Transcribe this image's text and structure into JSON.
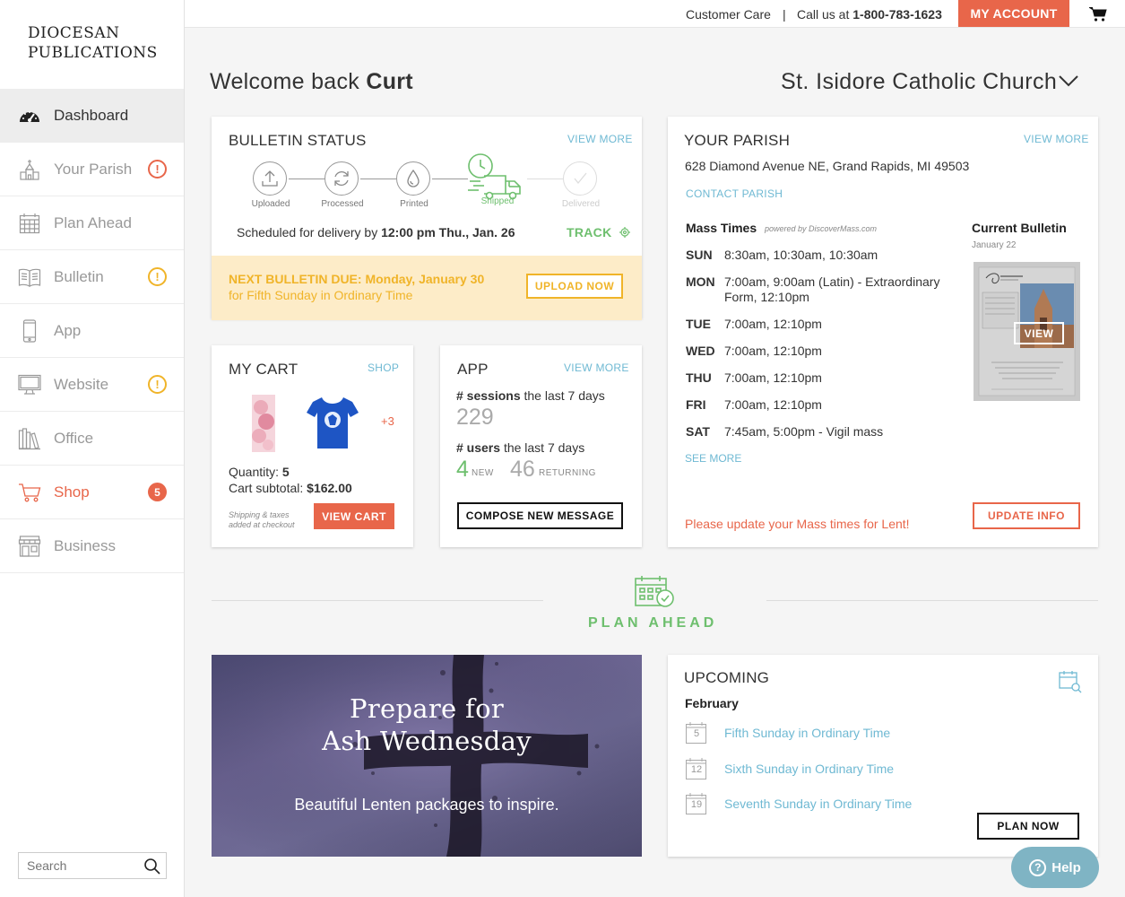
{
  "brand": {
    "line1": "DIOCESAN",
    "line2": "PUBLICATIONS"
  },
  "sidebar": {
    "items": [
      {
        "label": "Dashboard",
        "icon": "gauge-icon",
        "active": true
      },
      {
        "label": "Your Parish",
        "icon": "church-icon",
        "badge": "!"
      },
      {
        "label": "Plan Ahead",
        "icon": "calendar-icon"
      },
      {
        "label": "Bulletin",
        "icon": "book-icon",
        "badge": "!"
      },
      {
        "label": "App",
        "icon": "phone-icon"
      },
      {
        "label": "Website",
        "icon": "monitor-icon",
        "badge": "!"
      },
      {
        "label": "Office",
        "icon": "books-icon"
      },
      {
        "label": "Shop",
        "icon": "cart-icon",
        "badge": "5"
      },
      {
        "label": "Business",
        "icon": "store-icon"
      }
    ],
    "search_placeholder": "Search"
  },
  "topbar": {
    "customer_care": "Customer Care",
    "separator": "|",
    "call_prefix": "Call us at",
    "phone": "1-800-783-1623",
    "my_account": "MY ACCOUNT"
  },
  "welcome": {
    "prefix": "Welcome back",
    "name": "Curt"
  },
  "church": {
    "name": "St. Isidore Catholic Church"
  },
  "bulletin_status": {
    "title": "BULLETIN STATUS",
    "view_more": "VIEW MORE",
    "steps": [
      "Uploaded",
      "Processed",
      "Printed",
      "Shipped",
      "Delivered"
    ],
    "schedule_prefix": "Scheduled for delivery by",
    "schedule_time": "12:00 pm Thu., Jan. 26",
    "track": "TRACK",
    "due_title": "NEXT BULLETIN DUE: Monday, January 30",
    "due_sub": "for Fifth Sunday in Ordinary Time",
    "upload": "UPLOAD NOW"
  },
  "cart": {
    "title": "MY CART",
    "shop": "SHOP",
    "more": "+3",
    "qty_label": "Quantity:",
    "qty": "5",
    "subtotal_label": "Cart subtotal:",
    "subtotal": "$162.00",
    "note1": "Shipping & taxes",
    "note2": "added at checkout",
    "view_cart": "VIEW CART"
  },
  "app": {
    "title": "APP",
    "view_more": "VIEW MORE",
    "sessions_bold": "# sessions",
    "sessions_rest": "the last 7 days",
    "sessions": "229",
    "users_bold": "# users",
    "users_rest": "the last 7 days",
    "new_count": "4",
    "new_label": "NEW",
    "returning_count": "46",
    "returning_label": "RETURNING",
    "compose": "COMPOSE NEW MESSAGE"
  },
  "parish": {
    "title": "YOUR PARISH",
    "view_more": "VIEW MORE",
    "address": "628 Diamond Avenue NE, Grand Rapids, MI 49503",
    "contact": "CONTACT PARISH",
    "mass_title": "Mass Times",
    "powered": "powered by DiscoverMass.com",
    "mass": [
      {
        "day": "SUN",
        "times": "8:30am, 10:30am, 10:30am"
      },
      {
        "day": "MON",
        "times": "7:00am, 9:00am (Latin) - Extraordinary Form, 12:10pm"
      },
      {
        "day": "TUE",
        "times": "7:00am, 12:10pm"
      },
      {
        "day": "WED",
        "times": "7:00am, 12:10pm"
      },
      {
        "day": "THU",
        "times": "7:00am, 12:10pm"
      },
      {
        "day": "FRI",
        "times": "7:00am, 12:10pm"
      },
      {
        "day": "SAT",
        "times": "7:45am, 5:00pm - Vigil mass"
      }
    ],
    "see_more": "SEE MORE",
    "current_bulletin": "Current Bulletin",
    "bulletin_date": "January 22",
    "view": "VIEW",
    "lent_notice": "Please update your Mass times for Lent!",
    "update": "UPDATE INFO"
  },
  "plan_ahead": {
    "label": "PLAN AHEAD"
  },
  "hero": {
    "title1": "Prepare for",
    "title2": "Ash Wednesday",
    "subtitle": "Beautiful Lenten packages to inspire."
  },
  "upcoming": {
    "title": "UPCOMING",
    "month": "February",
    "items": [
      {
        "day": "5",
        "label": "Fifth Sunday in Ordinary Time"
      },
      {
        "day": "12",
        "label": "Sixth Sunday in Ordinary Time"
      },
      {
        "day": "19",
        "label": "Seventh Sunday in Ordinary Time"
      }
    ],
    "plan_now": "PLAN NOW"
  },
  "help": {
    "label": "Help"
  },
  "colors": {
    "accent": "#e8664a",
    "warning": "#f0b429",
    "success": "#6ebf6e",
    "link": "#6fb9d3"
  }
}
